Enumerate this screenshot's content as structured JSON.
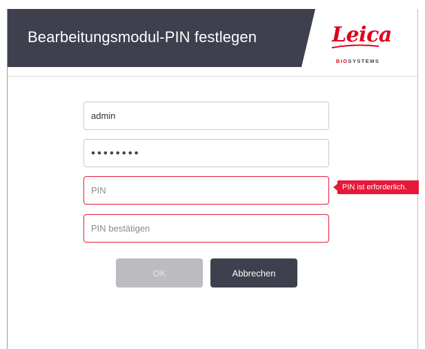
{
  "header": {
    "title": "Bearbeitungsmodul-PIN festlegen",
    "logo_text": "Leica",
    "logo_sub_first": "BIO",
    "logo_sub_rest": "SYSTEMS",
    "brand_color": "#e0001b",
    "band_color": "#3f404d"
  },
  "form": {
    "username_value": "admin",
    "password_display": "••••••••",
    "pin_placeholder": "PIN",
    "pin_confirm_placeholder": "PIN bestätigen",
    "pin_error": "PIN ist erforderlich.",
    "error_color": "#e5193a"
  },
  "buttons": {
    "ok_label": "OK",
    "cancel_label": "Abbrechen"
  }
}
